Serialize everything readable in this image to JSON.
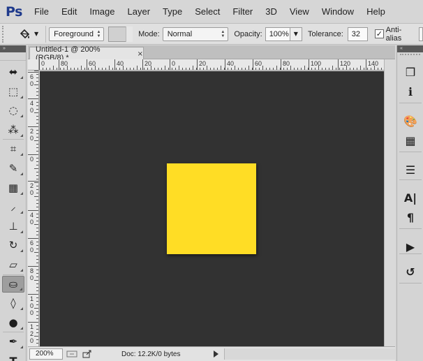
{
  "app": {
    "logo_text": "Ps",
    "brand_color": "#31a8ff"
  },
  "menu": [
    "File",
    "Edit",
    "Image",
    "Layer",
    "Type",
    "Select",
    "Filter",
    "3D",
    "View",
    "Window",
    "Help"
  ],
  "options_bar": {
    "fill_source": "Foreground",
    "mode_label": "Mode:",
    "mode_value": "Normal",
    "opacity_label": "Opacity:",
    "opacity_value": "100%",
    "tolerance_label": "Tolerance:",
    "tolerance_value": "32",
    "antialias_label": "Anti-alias",
    "antialias_checked": true
  },
  "tools": [
    {
      "name": "move-tool-icon",
      "glyph": "⬌"
    },
    {
      "name": "marquee-tool-icon",
      "glyph": "⬚"
    },
    {
      "name": "lasso-tool-icon",
      "glyph": "◌"
    },
    {
      "name": "magic-wand-tool-icon",
      "glyph": "⁂"
    },
    {
      "name": "crop-tool-icon",
      "glyph": "⌗"
    },
    {
      "name": "eyedropper-tool-icon",
      "glyph": "✎"
    },
    {
      "name": "healing-brush-tool-icon",
      "glyph": "▦"
    },
    {
      "name": "brush-tool-icon",
      "glyph": "⸝"
    },
    {
      "name": "clone-stamp-tool-icon",
      "glyph": "⊥"
    },
    {
      "name": "history-brush-tool-icon",
      "glyph": "↻"
    },
    {
      "name": "eraser-tool-icon",
      "glyph": "▱"
    },
    {
      "name": "paint-bucket-tool-icon",
      "glyph": "⛀",
      "active": true
    },
    {
      "name": "blur-tool-icon",
      "glyph": "◊"
    },
    {
      "name": "dodge-tool-icon",
      "glyph": "●"
    },
    {
      "name": "pen-tool-icon",
      "glyph": "✒"
    },
    {
      "name": "type-tool-icon",
      "glyph": "T"
    }
  ],
  "document": {
    "tab_title": "Untitled-1 @ 200% (RGB/8) *",
    "canvas_color": "#323232",
    "shape_color": "#ffdd25",
    "ruler_top_labels": [
      "0",
      "80",
      "60",
      "40",
      "20",
      "0",
      "20",
      "40",
      "60",
      "80",
      "100",
      "120",
      "140"
    ],
    "ruler_left_labels": [
      "6\n0",
      "4\n0",
      "2\n0",
      "0",
      "2\n0",
      "4\n0",
      "6\n0",
      "8\n0",
      "1\n0\n0",
      "1\n2\n0"
    ]
  },
  "status": {
    "zoom": "200%",
    "doc_info": "Doc: 12.2K/0 bytes"
  },
  "right_dock": [
    {
      "name": "3d-panel-icon",
      "glyph": "❒"
    },
    {
      "name": "info-panel-icon",
      "glyph": "ℹ"
    },
    {
      "name": "color-panel-icon",
      "glyph": "🎨"
    },
    {
      "name": "swatches-panel-icon",
      "glyph": "▦"
    },
    {
      "name": "adjustments-panel-icon",
      "glyph": "☰"
    },
    {
      "name": "character-panel-icon",
      "glyph": "A|"
    },
    {
      "name": "paragraph-panel-icon",
      "glyph": "¶"
    },
    {
      "name": "actions-panel-icon",
      "glyph": "▶"
    },
    {
      "name": "history-panel-icon",
      "glyph": "↺"
    }
  ]
}
